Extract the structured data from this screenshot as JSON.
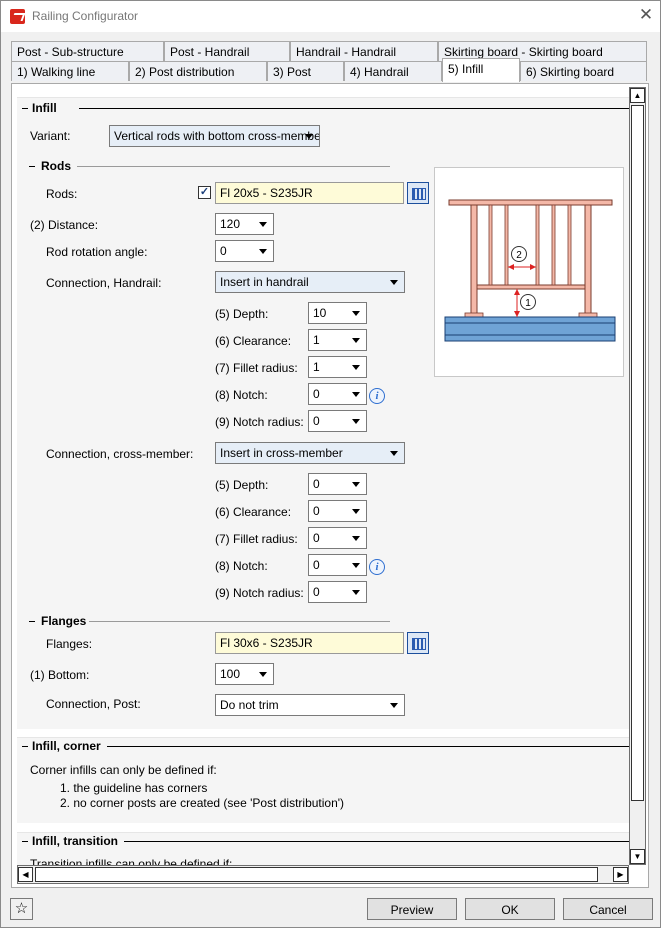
{
  "window": {
    "title": "Railing Configurator"
  },
  "tabs_row1": [
    "Post - Sub-structure",
    "Post - Handrail",
    "Handrail - Handrail",
    "Skirting board - Skirting board"
  ],
  "tabs_row2": [
    "1) Walking line",
    "2) Post distribution",
    "3) Post",
    "4) Handrail",
    "5) Infill",
    "6) Skirting board"
  ],
  "active_tab": "5) Infill",
  "infill": {
    "header": "Infill",
    "variant_label": "Variant:",
    "variant_value": "Vertical rods with bottom cross-member",
    "rods": {
      "header": "Rods",
      "rods_label": "Rods:",
      "rods_checked": true,
      "rods_value": "Fl 20x5 - S235JR",
      "distance_label": "(2) Distance:",
      "distance_value": "120",
      "rotation_label": "Rod rotation angle:",
      "rotation_value": "0",
      "conn_handrail_label": "Connection, Handrail:",
      "conn_handrail_value": "Insert in handrail",
      "handrail_params": [
        {
          "label": "(5) Depth:",
          "value": "10"
        },
        {
          "label": "(6) Clearance:",
          "value": "1"
        },
        {
          "label": "(7) Fillet radius:",
          "value": "1"
        },
        {
          "label": "(8) Notch:",
          "value": "0"
        },
        {
          "label": "(9) Notch radius:",
          "value": "0"
        }
      ],
      "conn_cross_label": "Connection, cross-member:",
      "conn_cross_value": "Insert in cross-member",
      "cross_params": [
        {
          "label": "(5) Depth:",
          "value": "0"
        },
        {
          "label": "(6) Clearance:",
          "value": "0"
        },
        {
          "label": "(7) Fillet radius:",
          "value": "0"
        },
        {
          "label": "(8) Notch:",
          "value": "0"
        },
        {
          "label": "(9) Notch radius:",
          "value": "0"
        }
      ]
    },
    "flanges": {
      "header": "Flanges",
      "flanges_label": "Flanges:",
      "flanges_value": "Fl 30x6 - S235JR",
      "bottom_label": "(1) Bottom:",
      "bottom_value": "100",
      "conn_post_label": "Connection, Post:",
      "conn_post_value": "Do not trim"
    },
    "diagram_callouts": [
      "1",
      "2"
    ]
  },
  "infill_corner": {
    "header": "Infill, corner",
    "note": "Corner infills can only be defined if:",
    "items": [
      "1. the guideline has corners",
      "2. no corner posts are created (see 'Post distribution')"
    ]
  },
  "infill_transition": {
    "header": "Infill, transition",
    "note": "Transition infills can only be defined if:"
  },
  "buttons": {
    "preview": "Preview",
    "ok": "OK",
    "cancel": "Cancel"
  },
  "icons": [
    "close-icon",
    "star-icon",
    "info-icon",
    "catalog-icon"
  ],
  "colors": {
    "field_yellow": "#fefbd8",
    "railing_salmon": "#f4b8a8",
    "base_blue": "#6fa3d6"
  }
}
